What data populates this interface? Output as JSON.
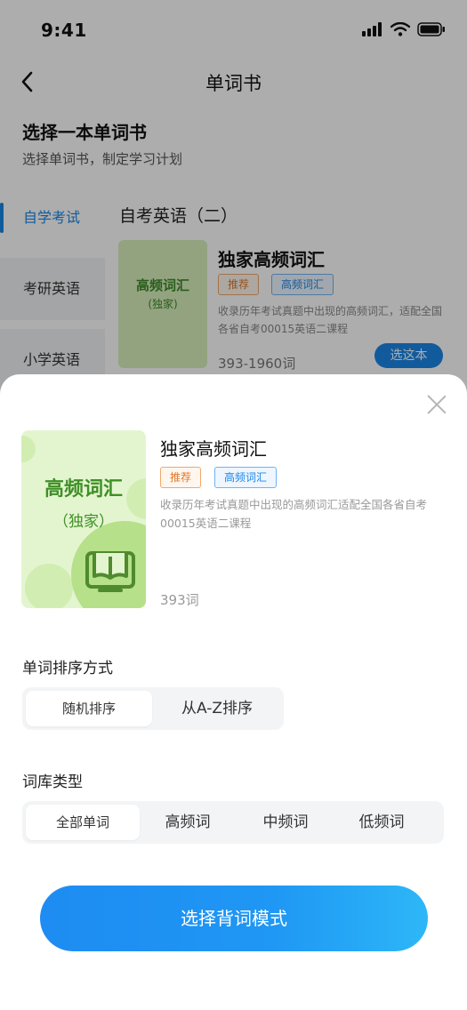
{
  "status_bar": {
    "time": "9:41"
  },
  "nav": {
    "title": "单词书"
  },
  "page": {
    "heading": "选择一本单词书",
    "subheading": "选择单词书，制定学习计划"
  },
  "sidebar": {
    "items": [
      {
        "label": "自学考试"
      },
      {
        "label": "考研英语"
      },
      {
        "label": "小学英语"
      }
    ]
  },
  "category": {
    "title": "自考英语（二）"
  },
  "background_book": {
    "cover_title": "高频词汇",
    "cover_subtitle": "(独家)",
    "title": "独家高频词汇",
    "tag_recommend": "推荐",
    "tag_high": "高频词汇",
    "description": "收录历年考试真题中出现的高频词汇，适配全国各省自考00015英语二课程",
    "count": "393-1960词",
    "choose_label": "选这本"
  },
  "sheet": {
    "cover_title": "高频词汇",
    "cover_subtitle": "（独家）",
    "title": "独家高频词汇",
    "tag_recommend": "推荐",
    "tag_high": "高频词汇",
    "description": "收录历年考试真题中出现的高频词汇适配全国各省自考00015英语二课程",
    "count": "393词",
    "sort_label": "单词排序方式",
    "sort_options": [
      "随机排序",
      "从A-Z排序"
    ],
    "sort_selected": "随机排序",
    "type_label": "词库类型",
    "type_options": [
      "全部单词",
      "高频词",
      "中频词",
      "低频词"
    ],
    "type_selected": "全部单词",
    "confirm_label": "选择背词模式"
  },
  "colors": {
    "accent": "#1a86e8",
    "green": "#3f8f27",
    "recommend": "#e0782a"
  }
}
